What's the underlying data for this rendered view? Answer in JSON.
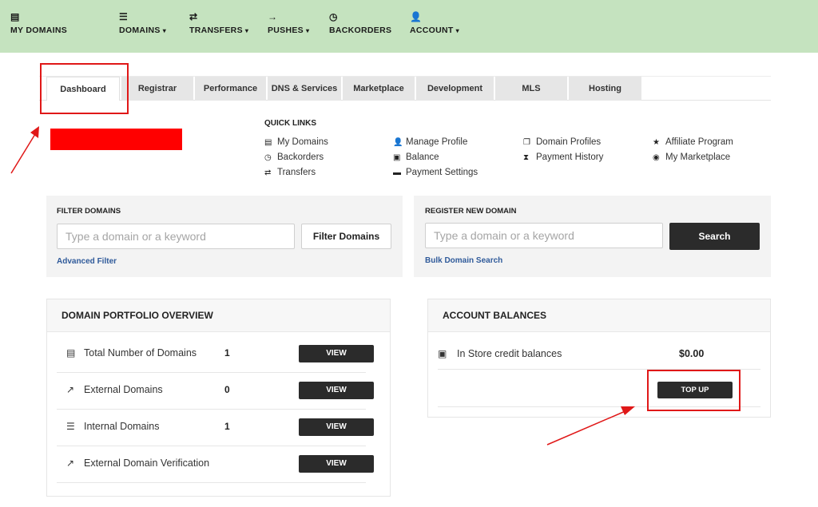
{
  "topnav": {
    "items": [
      {
        "label": "MY DOMAINS",
        "icon": "list-icon",
        "glyph": "▤",
        "caret": ""
      },
      {
        "label": "DOMAINS",
        "icon": "bullet-list-icon",
        "glyph": "☰",
        "caret": "▾"
      },
      {
        "label": "TRANSFERS",
        "icon": "transfer-arrows-icon",
        "glyph": "⇄",
        "caret": "▾"
      },
      {
        "label": "PUSHES",
        "icon": "arrow-right-icon",
        "glyph": "→",
        "caret": "▾"
      },
      {
        "label": "BACKORDERS",
        "icon": "clock-icon",
        "glyph": "◷",
        "caret": ""
      },
      {
        "label": "ACCOUNT",
        "icon": "user-icon",
        "glyph": "👤",
        "caret": "▾"
      }
    ]
  },
  "tabs": [
    "Dashboard",
    "Registrar",
    "Performance",
    "DNS & Services",
    "Marketplace",
    "Development",
    "MLS",
    "Hosting"
  ],
  "quick_links": {
    "title": "QUICK LINKS",
    "items": [
      {
        "label": "My Domains",
        "icon": "list-icon",
        "glyph": "▤"
      },
      {
        "label": "Backorders",
        "icon": "clock-icon",
        "glyph": "◷"
      },
      {
        "label": "Transfers",
        "icon": "transfer-arrows-icon",
        "glyph": "⇄"
      },
      {
        "label": "Manage Profile",
        "icon": "user-icon",
        "glyph": "👤"
      },
      {
        "label": "Balance",
        "icon": "money-icon",
        "glyph": "▣"
      },
      {
        "label": "Payment Settings",
        "icon": "credit-card-icon",
        "glyph": "▬"
      },
      {
        "label": "Domain Profiles",
        "icon": "copy-icon",
        "glyph": "❐"
      },
      {
        "label": "Payment History",
        "icon": "hourglass-icon",
        "glyph": "⧗"
      },
      {
        "label": "Affiliate Program",
        "icon": "star-icon",
        "glyph": "★"
      },
      {
        "label": "My Marketplace",
        "icon": "target-icon",
        "glyph": "◉"
      }
    ]
  },
  "filter": {
    "title": "FILTER DOMAINS",
    "placeholder": "Type a domain or a keyword",
    "button": "Filter Domains",
    "link": "Advanced Filter"
  },
  "register": {
    "title": "REGISTER NEW DOMAIN",
    "placeholder": "Type a domain or a keyword",
    "button": "Search",
    "link": "Bulk Domain Search"
  },
  "portfolio": {
    "title": "DOMAIN PORTFOLIO OVERVIEW",
    "rows": [
      {
        "label": "Total Number of Domains",
        "count": "1",
        "button": "VIEW",
        "icon": "list-icon",
        "glyph": "▤"
      },
      {
        "label": "External Domains",
        "count": "0",
        "button": "VIEW",
        "icon": "external-link-icon",
        "glyph": "↗"
      },
      {
        "label": "Internal Domains",
        "count": "1",
        "button": "VIEW",
        "icon": "bullet-list-icon",
        "glyph": "☰"
      },
      {
        "label": "External Domain Verification",
        "count": "",
        "button": "VIEW",
        "icon": "external-link-icon",
        "glyph": "↗"
      }
    ]
  },
  "balances": {
    "title": "ACCOUNT BALANCES",
    "label": "In Store credit balances",
    "icon": "money-icon",
    "glyph": "▣",
    "amount": "$0.00",
    "topup": "TOP UP"
  },
  "colors": {
    "nav_bg": "#c5e3bf",
    "annotation_red": "#e01818",
    "button_dark": "#2b2b2b",
    "link_blue": "#2f5a9a"
  }
}
